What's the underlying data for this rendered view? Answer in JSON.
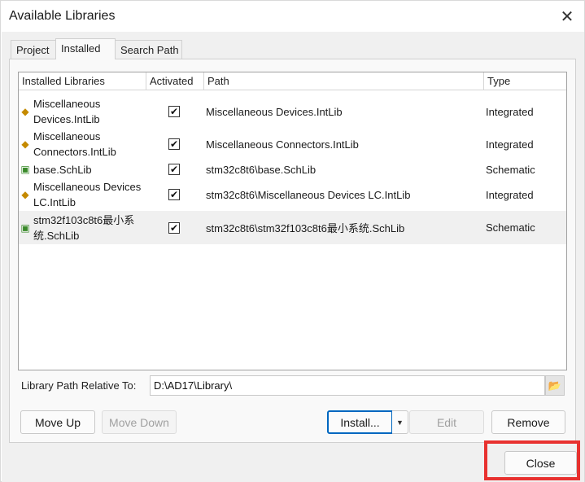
{
  "window": {
    "title": "Available Libraries"
  },
  "tabs": [
    {
      "label": "Project"
    },
    {
      "label": "Installed"
    },
    {
      "label": "Search Path"
    }
  ],
  "columns": {
    "name": "Installed Libraries",
    "activated": "Activated",
    "path": "Path",
    "type": "Type"
  },
  "rows": [
    {
      "name": "Miscellaneous Devices.IntLib",
      "activated": true,
      "path": "Miscellaneous Devices.IntLib",
      "type": "Integrated",
      "icon": "integrated-library-icon"
    },
    {
      "name": "Miscellaneous Connectors.IntLib",
      "activated": true,
      "path": "Miscellaneous Connectors.IntLib",
      "type": "Integrated",
      "icon": "integrated-library-icon"
    },
    {
      "name": "base.SchLib",
      "activated": true,
      "path": "stm32c8t6\\base.SchLib",
      "type": "Schematic",
      "icon": "schematic-library-icon"
    },
    {
      "name": "Miscellaneous Devices LC.IntLib",
      "activated": true,
      "path": "stm32c8t6\\Miscellaneous Devices LC.IntLib",
      "type": "Integrated",
      "icon": "integrated-library-icon"
    },
    {
      "name": "stm32f103c8t6最小系统.SchLib",
      "activated": true,
      "path": "stm32c8t6\\stm32f103c8t6最小系统.SchLib",
      "type": "Schematic",
      "icon": "schematic-library-icon"
    }
  ],
  "library_path": {
    "label": "Library Path Relative To:",
    "value": "D:\\AD17\\Library\\"
  },
  "buttons": {
    "move_up": "Move Up",
    "move_down": "Move Down",
    "install": "Install...",
    "edit": "Edit",
    "remove": "Remove",
    "close": "Close"
  },
  "colors": {
    "highlight": "#e8312f",
    "accent": "#0067c0"
  }
}
